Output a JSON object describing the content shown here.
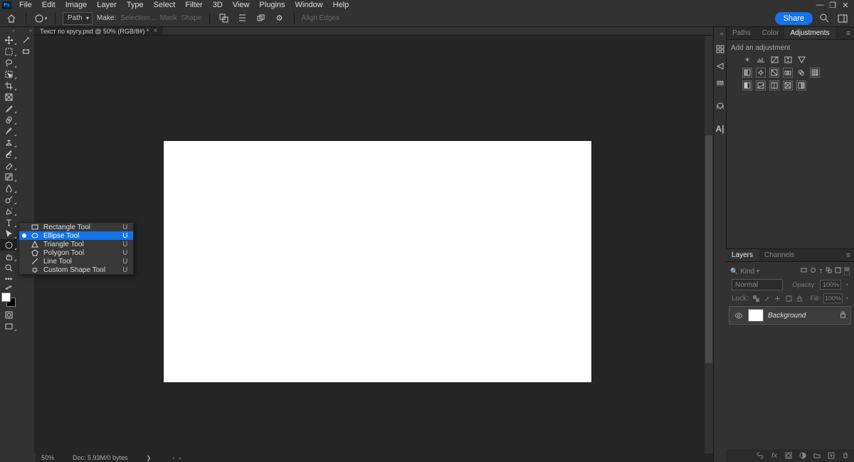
{
  "app": {
    "logo": "Ps"
  },
  "menu": [
    "File",
    "Edit",
    "Image",
    "Layer",
    "Type",
    "Select",
    "Filter",
    "3D",
    "View",
    "Plugins",
    "Window",
    "Help"
  ],
  "options": {
    "mode_label": "Path",
    "make_label": "Make:",
    "make_selection": "Selection...",
    "make_mask": "Mask",
    "make_shape": "Shape",
    "align_edges": "Align Edges",
    "share": "Share"
  },
  "document": {
    "tab_title": "Текст по кругу.psd @ 50% (RGB/8#) *"
  },
  "shape_flyout": [
    {
      "label": "Rectangle Tool",
      "shortcut": "U",
      "selected": false
    },
    {
      "label": "Ellipse Tool",
      "shortcut": "U",
      "selected": true
    },
    {
      "label": "Triangle Tool",
      "shortcut": "U",
      "selected": false
    },
    {
      "label": "Polygon Tool",
      "shortcut": "U",
      "selected": false
    },
    {
      "label": "Line Tool",
      "shortcut": "U",
      "selected": false
    },
    {
      "label": "Custom Shape Tool",
      "shortcut": "U",
      "selected": false
    }
  ],
  "status": {
    "zoom": "50%",
    "doc_size": "Doc: 5.93M/0 bytes"
  },
  "panels": {
    "top_tabs": [
      "Paths",
      "Color",
      "Adjustments"
    ],
    "top_active": "Adjustments",
    "adjustments_title": "Add an adjustment",
    "layers_tabs": [
      "Layers",
      "Channels"
    ],
    "layers_active": "Layers",
    "kind_label": "Kind",
    "blend_mode": "Normal",
    "opacity_label": "Opacity:",
    "opacity_value": "100%",
    "lock_label": "Lock:",
    "fill_label": "Fill:",
    "fill_value": "100%",
    "layer": {
      "name": "Background"
    },
    "search_placeholder": "Kind"
  }
}
